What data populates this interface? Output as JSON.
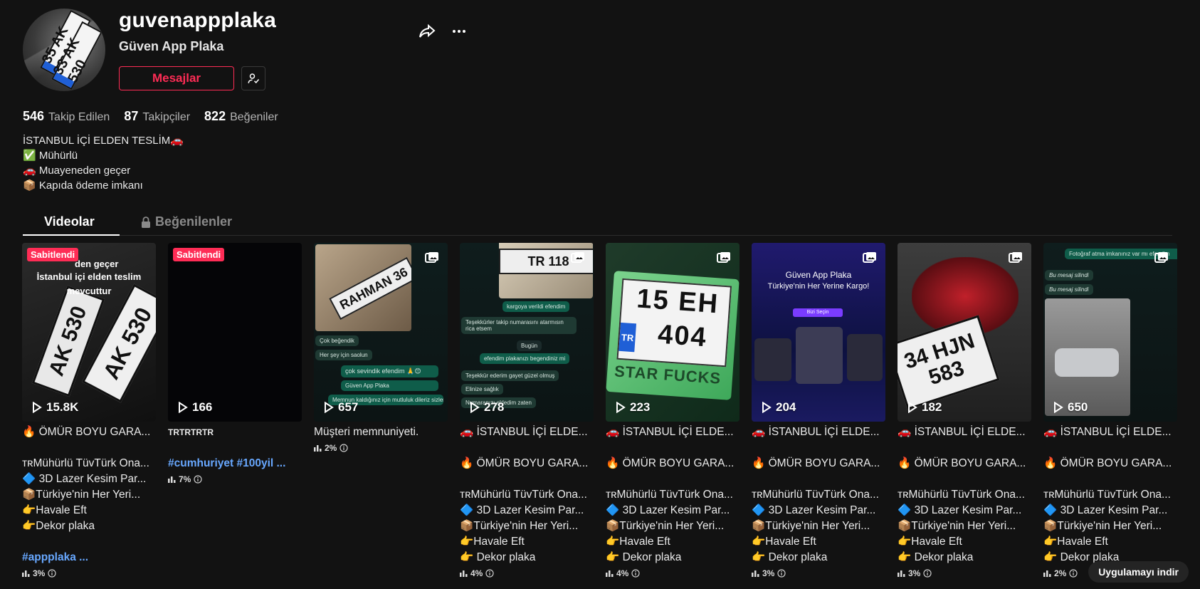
{
  "profile": {
    "username": "guvenappplaka",
    "display_name": "Güven App Plaka",
    "message_label": "Mesajlar",
    "avatar_plate_1": "35 AK 530",
    "avatar_plate_2": "33 AK 530"
  },
  "stats": [
    {
      "value": "546",
      "label": "Takip Edilen"
    },
    {
      "value": "87",
      "label": "Takipçiler"
    },
    {
      "value": "822",
      "label": "Beğeniler"
    }
  ],
  "bio": [
    "İSTANBUL İÇİ ELDEN TESLİM🚗",
    "✅ Mühürlü",
    "🚗 Muayeneden geçer",
    "📦 Kapıda ödeme imkanı"
  ],
  "tabs": {
    "videos": "Videolar",
    "liked": "Beğenilenler"
  },
  "videos": [
    {
      "views": "15.8K",
      "pinned": "Sabitlendi",
      "thumb_text_1": "den geçer",
      "thumb_text_2": "İstanbul içi elden teslim",
      "thumb_text_3": "mevcuttur",
      "caption": [
        "🔥 ÖMÜR BOYU GARA...",
        "",
        "ᴛʀMühürlü TüvTürk Ona...",
        "🔷 3D Lazer Kesim Par...",
        "📦Türkiye'nin Her Yeri...",
        "👉Havale Eft",
        "👉Dekor plaka",
        "",
        "#appplaka ..."
      ],
      "metric": "3%"
    },
    {
      "views": "166",
      "pinned": "Sabitlendi",
      "caption": [
        "TRTRTRTR",
        "",
        "#cumhuriyet #100yil ..."
      ],
      "metric": "7%"
    },
    {
      "views": "657",
      "plate": "RAHMAN 36",
      "bubbles": [
        "Çok beğendik",
        "Her şey için saolun",
        "çok sevindik efendim 🙏😊",
        "Güven App Plaka",
        "Memnun kaldığınız için mutluluk dileriz sizler adına"
      ],
      "caption": [
        "Müşteri memnuniyeti."
      ],
      "metric": "2%"
    },
    {
      "views": "278",
      "plate": "TR 118",
      "bubbles": [
        "kargoya verildi efendim",
        "Teşekkürler takip numarasını atarmısın rica etsem",
        "Bugün",
        "efendim plakanızı begendiniz mi",
        "Teşekkür ederim gayet güzel olmuş",
        "Elinize sağlık",
        "Numaranızı ekledim zaten"
      ],
      "caption": [
        "🚗 İSTANBUL İÇİ ELDE...",
        "",
        "🔥 ÖMÜR BOYU GARA...",
        "",
        "ᴛʀMühürlü TüvTürk Ona...",
        "🔷 3D Lazer Kesim Par...",
        "📦Türkiye'nin Her Yeri...",
        "👉Havale Eft",
        "👉 Dekor plaka"
      ],
      "metric": "4%"
    },
    {
      "views": "223",
      "plate_top": "15  EH",
      "plate_bottom": "404",
      "plate_band": "TR",
      "plate_frame": "STAR  FUCKS",
      "caption": [
        "🚗 İSTANBUL İÇİ ELDE...",
        "",
        "🔥 ÖMÜR BOYU GARA...",
        "",
        "ᴛʀMühürlü TüvTürk Ona...",
        "🔷 3D Lazer Kesim Par...",
        "📦Türkiye'nin Her Yeri...",
        "👉Havale Eft",
        "👉 Dekor plaka"
      ],
      "metric": "4%"
    },
    {
      "views": "204",
      "headline_1": "Güven App Plaka",
      "headline_2": "Türkiye'nin Her Yerine Kargo!",
      "cta": "Bizi Seçin",
      "caption": [
        "🚗 İSTANBUL İÇİ ELDE...",
        "",
        "🔥 ÖMÜR BOYU GARA...",
        "",
        "ᴛʀMühürlü TüvTürk Ona...",
        "🔷 3D Lazer Kesim Par...",
        "📦Türkiye'nin Her Yeri...",
        "👉Havale Eft",
        "👉 Dekor plaka"
      ],
      "metric": "3%"
    },
    {
      "views": "182",
      "plate": "34 HJN 583",
      "caption": [
        "🚗 İSTANBUL İÇİ ELDE...",
        "",
        "🔥 ÖMÜR BOYU GARA...",
        "",
        "ᴛʀMühürlü TüvTürk Ona...",
        "🔷 3D Lazer Kesim Par...",
        "📦Türkiye'nin Her Yeri...",
        "👉Havale Eft",
        "👉 Dekor plaka"
      ],
      "metric": "3%"
    },
    {
      "views": "650",
      "bubbles": [
        "Fotoğraf atma imkanınız var mı efendim",
        "Bu mesaj silindi",
        "Bu mesaj silindi"
      ],
      "caption": [
        "🚗 İSTANBUL İÇİ ELDE...",
        "",
        "🔥 ÖMÜR BOYU GARA...",
        "",
        "ᴛʀMühürlü TüvTürk Ona...",
        "🔷 3D Lazer Kesim Par...",
        "📦Türkiye'nin Her Yeri...",
        "👉Havale Eft",
        "👉 Dekor plaka"
      ],
      "metric": "2%"
    }
  ],
  "download_label": "Uygulamayı indir",
  "colors": {
    "accent": "#fe2c55",
    "link": "#68a8ff",
    "background": "#121212"
  }
}
